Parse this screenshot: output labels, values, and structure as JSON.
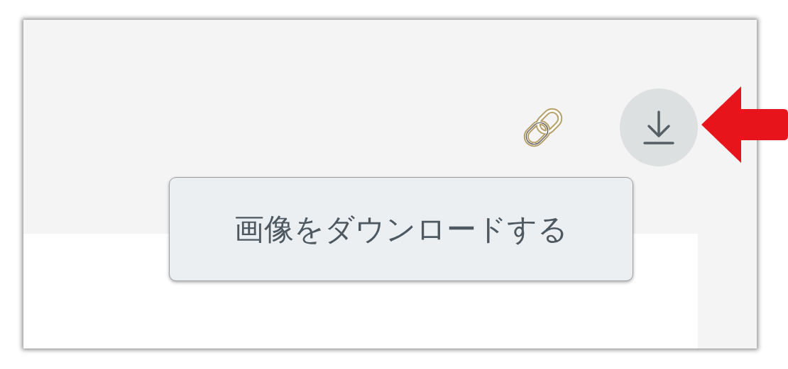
{
  "tooltip": {
    "text": "画像をダウンロードする"
  }
}
